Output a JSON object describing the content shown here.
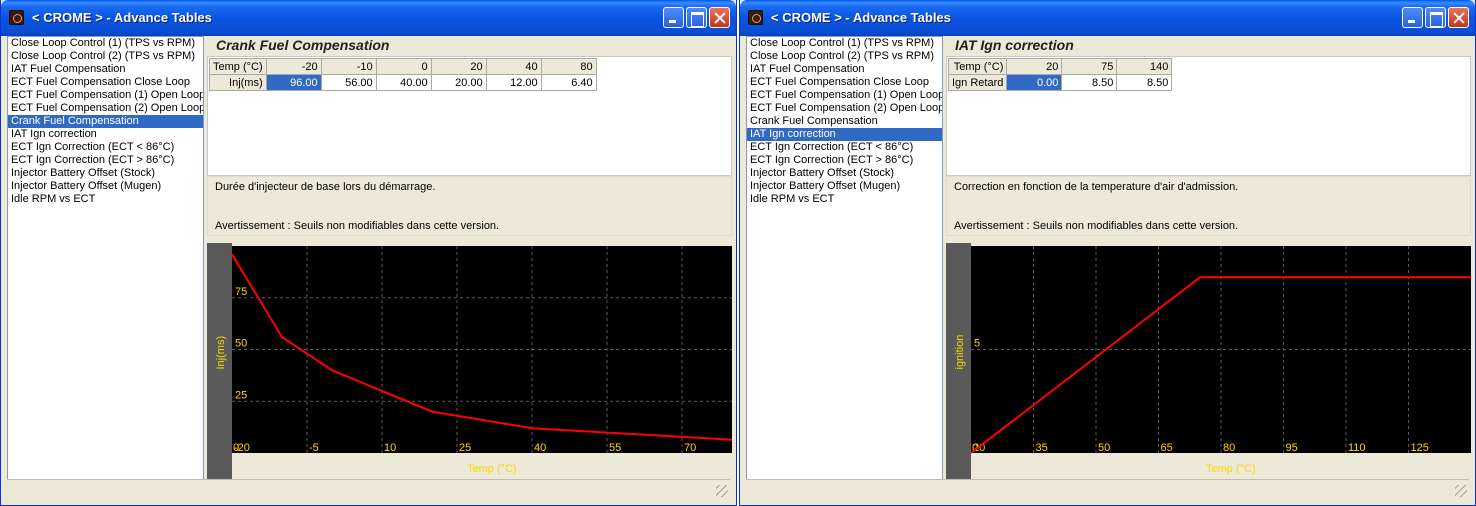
{
  "windows": [
    {
      "title": "< CROME > - Advance Tables",
      "table_list": [
        "Close Loop Control (1) (TPS vs RPM)",
        "Close Loop Control (2) (TPS vs RPM)",
        "IAT Fuel Compensation",
        "ECT Fuel Compensation Close Loop",
        "ECT Fuel Compensation (1) Open Loop",
        "ECT Fuel Compensation (2) Open Loop",
        "Crank Fuel Compensation",
        "IAT Ign correction",
        "ECT Ign Correction (ECT < 86°C)",
        "ECT Ign Correction (ECT > 86°C)",
        "Injector Battery Offset (Stock)",
        "Injector Battery Offset (Mugen)",
        "Idle RPM vs ECT"
      ],
      "selected_index": 6,
      "panel_title": "Crank Fuel Compensation",
      "grid": {
        "header_label": "Temp (°C)",
        "columns": [
          "-20",
          "-10",
          "0",
          "20",
          "40",
          "80"
        ],
        "row_label": "Inj(ms)",
        "values": [
          "96.00",
          "56.00",
          "40.00",
          "20.00",
          "12.00",
          "6.40"
        ],
        "selected_col": 0
      },
      "description": "Durée d'injecteur de base lors du démarrage.",
      "warning": "Avertissement : Seuils non modifiables dans cette version.",
      "colors": {
        "background": "#000000",
        "grid": "#5a5a5a",
        "line": "#ff0000",
        "axis_text": "#ffd700"
      },
      "chart_data": {
        "type": "line",
        "xlabel": "Temp (°C)",
        "ylabel": "Inj(ms)",
        "xlim": [
          -20,
          80
        ],
        "ylim": [
          0,
          100
        ],
        "x_ticks": [
          "-20",
          "-5",
          "10",
          "25",
          "40",
          "55",
          "70"
        ],
        "y_ticks": [
          "0",
          "25",
          "50",
          "75"
        ],
        "x": [
          -20,
          -10,
          0,
          20,
          40,
          80
        ],
        "y": [
          96,
          56,
          40,
          20,
          12,
          6.4
        ]
      }
    },
    {
      "title": "< CROME > - Advance Tables",
      "table_list": [
        "Close Loop Control (1) (TPS vs RPM)",
        "Close Loop Control (2) (TPS vs RPM)",
        "IAT Fuel Compensation",
        "ECT Fuel Compensation Close Loop",
        "ECT Fuel Compensation (1) Open Loop",
        "ECT Fuel Compensation (2) Open Loop",
        "Crank Fuel Compensation",
        "IAT Ign correction",
        "ECT Ign Correction (ECT < 86°C)",
        "ECT Ign Correction (ECT > 86°C)",
        "Injector Battery Offset (Stock)",
        "Injector Battery Offset (Mugen)",
        "Idle RPM vs ECT"
      ],
      "selected_index": 7,
      "panel_title": "IAT Ign correction",
      "grid": {
        "header_label": "Temp (°C)",
        "columns": [
          "20",
          "75",
          "140"
        ],
        "row_label": "Ign Retard",
        "values": [
          "0.00",
          "8.50",
          "8.50"
        ],
        "selected_col": 0
      },
      "description": "Correction en fonction de la temperature d'air d'admission.",
      "warning": "Avertissement : Seuils non modifiables dans cette version.",
      "colors": {
        "background": "#000000",
        "grid": "#5a5a5a",
        "line": "#ff0000",
        "axis_text": "#ffd700"
      },
      "chart_data": {
        "type": "line",
        "xlabel": "Temp (°C)",
        "ylabel": "ignition",
        "xlim": [
          20,
          140
        ],
        "ylim": [
          0,
          10
        ],
        "x_ticks": [
          "20",
          "35",
          "50",
          "65",
          "80",
          "95",
          "110",
          "125"
        ],
        "y_ticks": [
          "0",
          "5"
        ],
        "x": [
          20,
          75,
          140
        ],
        "y": [
          0,
          8.5,
          8.5
        ]
      }
    }
  ]
}
